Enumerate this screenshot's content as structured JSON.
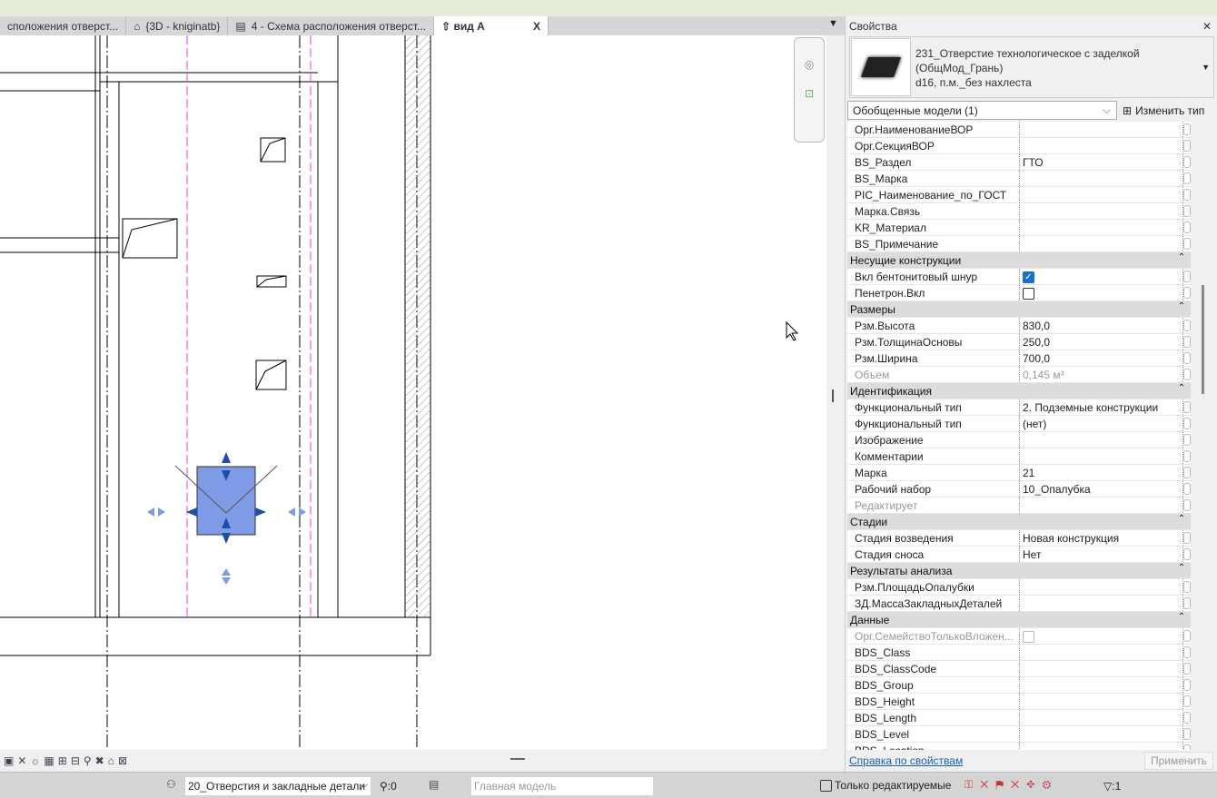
{
  "tabs": [
    {
      "label": "сположения отверст...",
      "icon": "plan-icon"
    },
    {
      "label": "{3D - kniginatb}",
      "icon": "3d-house-icon"
    },
    {
      "label": "4 - Схема расположения отверст...",
      "icon": "sheet-icon"
    },
    {
      "label": "вид А",
      "icon": "elevation-arrow-icon",
      "active": true
    }
  ],
  "tab_close": "X",
  "properties": {
    "title": "Свойства",
    "close": "✕",
    "type_line1": "231_Отверстие технологическое с заделкой",
    "type_line2": "(ОбщМод_Грань)",
    "type_line3": "d16, п.м._без нахлеста",
    "category": "Обобщенные модели (1)",
    "edit_type": "Изменить тип",
    "rows": [
      {
        "n": "Орг.НаименованиеВОР",
        "v": ""
      },
      {
        "n": "Орг.СекцияВОР",
        "v": ""
      },
      {
        "n": "BS_Раздел",
        "v": "ГТО"
      },
      {
        "n": "BS_Марка",
        "v": ""
      },
      {
        "n": "PIC_Наименование_по_ГОСТ",
        "v": ""
      },
      {
        "n": "Марка.Связь",
        "v": ""
      },
      {
        "n": "KR_Материал",
        "v": ""
      },
      {
        "n": "BS_Примечание",
        "v": ""
      },
      {
        "group": "Несущие конструкции"
      },
      {
        "n": "Вкл бентонитовый шнур",
        "check": true
      },
      {
        "n": "Пенетрон.Вкл",
        "check": false
      },
      {
        "group": "Размеры"
      },
      {
        "n": "Рзм.Высота",
        "v": "830,0"
      },
      {
        "n": "Рзм.ТолщинаОсновы",
        "v": "250,0"
      },
      {
        "n": "Рзм.Ширина",
        "v": "700,0"
      },
      {
        "n": "Объем",
        "v": "0,145 м³",
        "disabled": true
      },
      {
        "group": "Идентификация"
      },
      {
        "n": "Функциональный тип",
        "v": "2. Подземные конструкции"
      },
      {
        "n": "Функциональный тип",
        "v": "(нет)"
      },
      {
        "n": "Изображение",
        "v": ""
      },
      {
        "n": "Комментарии",
        "v": ""
      },
      {
        "n": "Марка",
        "v": "21"
      },
      {
        "n": "Рабочий набор",
        "v": "10_Опалубка"
      },
      {
        "n": "Редактирует",
        "v": "",
        "disabled": true
      },
      {
        "group": "Стадии"
      },
      {
        "n": "Стадия возведения",
        "v": "Новая конструкция"
      },
      {
        "n": "Стадия сноса",
        "v": "Нет"
      },
      {
        "group": "Результаты анализа"
      },
      {
        "n": "Рзм.ПлощадьОпалубки",
        "v": ""
      },
      {
        "n": "ЗД.МассаЗакладныхДеталей",
        "v": ""
      },
      {
        "group": "Данные"
      },
      {
        "n": "Орг.СемействоТолькоВложен...",
        "check": false,
        "disabled": true
      },
      {
        "n": "BDS_Class",
        "v": ""
      },
      {
        "n": "BDS_ClassCode",
        "v": ""
      },
      {
        "n": "BDS_Group",
        "v": ""
      },
      {
        "n": "BDS_Height",
        "v": ""
      },
      {
        "n": "BDS_Length",
        "v": ""
      },
      {
        "n": "BDS_Level",
        "v": ""
      },
      {
        "n": "BDS_Location",
        "v": ""
      }
    ],
    "help_link": "Справка по свойствам",
    "apply": "Применить"
  },
  "statusbar": {
    "workset": "20_Отверстия и закладные детали",
    "workset_count": ":0",
    "model": "Главная модель",
    "only_editable": "Только редактируемые",
    "filter_count": ":1"
  },
  "colors": {
    "selection": "#7f9be6",
    "grip": "#1e4fa8",
    "ref_line": "#e040e0",
    "link": "#1a5fb4",
    "checkbox": "#1a6fc9"
  }
}
